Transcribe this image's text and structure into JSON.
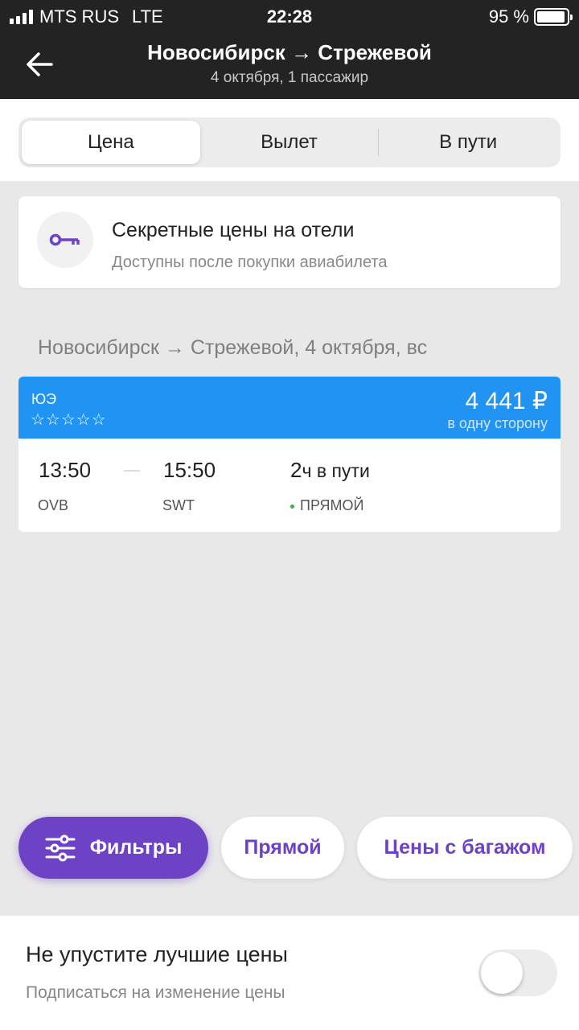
{
  "status_bar": {
    "carrier": "MTS RUS",
    "network": "LTE",
    "time": "22:28",
    "battery": "95 %",
    "battery_level": 0.95
  },
  "header": {
    "title": "Новосибирск → Стрежевой",
    "subtitle": "4 октября, 1 пассажир",
    "back_icon": "arrow-left-icon"
  },
  "sort_tabs": [
    {
      "label": "Цена",
      "active": true
    },
    {
      "label": "Вылет",
      "active": false
    },
    {
      "label": "В пути",
      "active": false
    }
  ],
  "hotel_promo": {
    "icon": "key-icon",
    "title": "Секретные цены на отели",
    "subtitle": "Доступны после покупки авиабилета"
  },
  "route_label": "Новосибирск → Стрежевой, 4 октября, вс",
  "ticket": {
    "airline": "ЮЭ",
    "rating": "☆☆☆☆☆",
    "price": "4 441 ₽",
    "price_note": "в одну сторону",
    "depart_time": "13:50",
    "depart_code": "OVB",
    "arrive_time": "15:50",
    "arrive_code": "SWT",
    "duration_num": "2",
    "duration_unit": "ч в пути",
    "stops": "ПРЯМОЙ"
  },
  "filters": {
    "filters_label": "Фильтры",
    "direct_label": "Прямой",
    "baggage_label": "Цены с багажом"
  },
  "subscribe": {
    "title": "Не упустите лучшие цены",
    "subtitle": "Подписаться на изменение цены",
    "enabled": false
  },
  "colors": {
    "header_bg": "#232323",
    "accent": "#6d42c4",
    "ticket_head": "#2193f3",
    "direct_dot": "#3cb043"
  }
}
